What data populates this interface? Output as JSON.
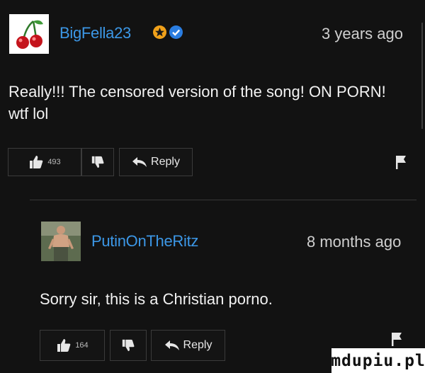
{
  "comments": [
    {
      "username": "BigFella23",
      "timestamp": "3 years ago",
      "text": "Really!!! The censored version of the song! ON PORN! wtf lol",
      "likes": "493",
      "reply_label": "Reply",
      "badges": [
        {
          "icon": "star-badge-icon",
          "color": "#f0a11a"
        },
        {
          "icon": "check-badge-icon",
          "color": "#2a7de1"
        }
      ],
      "avatar_icon": "cherries-avatar-icon"
    },
    {
      "username": "PutinOnTheRitz",
      "timestamp": "8 months ago",
      "text": "Sorry sir, this is a Christian porno.",
      "likes": "164",
      "reply_label": "Reply",
      "avatar_icon": "shirtless-man-avatar-icon"
    }
  ],
  "colors": {
    "background": "#121212",
    "username": "#3c97e6",
    "text": "#f2f2f2"
  },
  "watermark": "mdupiu.pl"
}
